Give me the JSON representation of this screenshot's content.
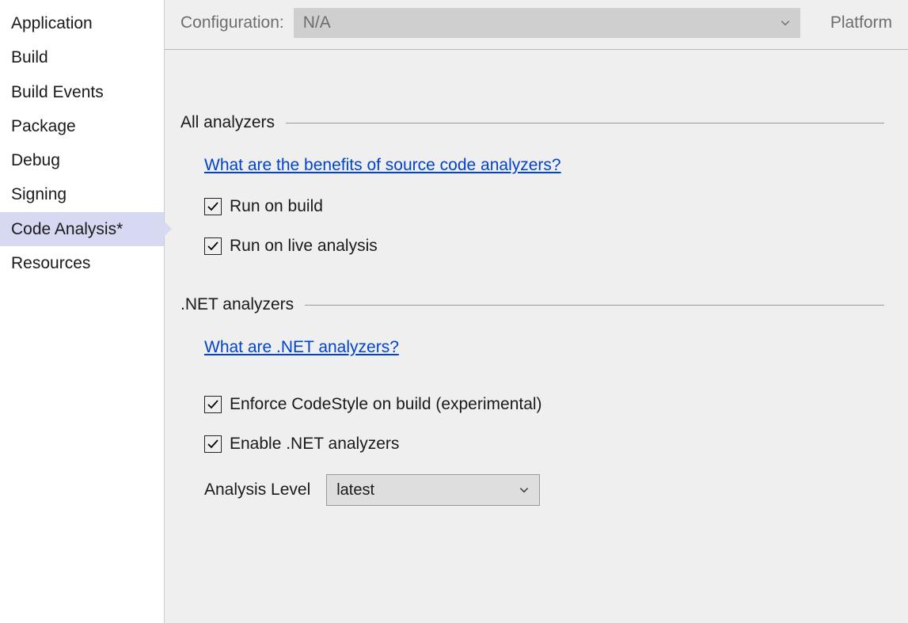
{
  "sidebar": {
    "items": [
      {
        "label": "Application",
        "selected": false
      },
      {
        "label": "Build",
        "selected": false
      },
      {
        "label": "Build Events",
        "selected": false
      },
      {
        "label": "Package",
        "selected": false
      },
      {
        "label": "Debug",
        "selected": false
      },
      {
        "label": "Signing",
        "selected": false
      },
      {
        "label": "Code Analysis*",
        "selected": true
      },
      {
        "label": "Resources",
        "selected": false
      }
    ]
  },
  "header": {
    "configuration_label": "Configuration:",
    "configuration_value": "N/A",
    "platform_label": "Platform"
  },
  "sections": {
    "all_analyzers": {
      "title": "All analyzers",
      "link": "What are the benefits of source code analyzers?",
      "checkboxes": [
        {
          "label": "Run on build",
          "checked": true
        },
        {
          "label": "Run on live analysis",
          "checked": true
        }
      ]
    },
    "net_analyzers": {
      "title": ".NET analyzers",
      "link": "What are .NET analyzers?",
      "checkboxes": [
        {
          "label": "Enforce CodeStyle on build (experimental)",
          "checked": true
        },
        {
          "label": "Enable .NET analyzers",
          "checked": true
        }
      ],
      "analysis_level_label": "Analysis Level",
      "analysis_level_value": "latest"
    }
  }
}
